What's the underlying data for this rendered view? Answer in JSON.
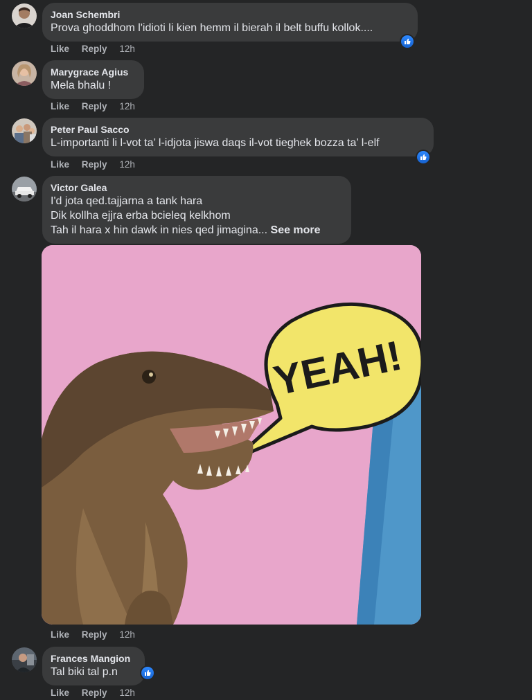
{
  "comments": [
    {
      "author": "Joan Schembri",
      "lines": [
        "Prova ghoddhom l'idioti li kien hemm il bierah il belt buffu kollok...."
      ],
      "like": "Like",
      "reply": "Reply",
      "time": "12h",
      "avatar_icon": "user-avatar",
      "reaction_icon": "like-reaction-icon"
    },
    {
      "author": "Marygrace Agius",
      "lines": [
        "Mela bhalu !"
      ],
      "like": "Like",
      "reply": "Reply",
      "time": "12h",
      "avatar_icon": "user-avatar"
    },
    {
      "author": "Peter Paul Sacco",
      "lines": [
        "L-importanti li l-vot ta’ l-idjota jiswa daqs il-vot tieghek bozza ta’ l-elf"
      ],
      "like": "Like",
      "reply": "Reply",
      "time": "12h",
      "avatar_icon": "user-avatar",
      "reaction_icon": "like-reaction-icon"
    },
    {
      "author": "Victor Galea",
      "lines": [
        "I'd jota qed.tajjarna a tank hara",
        "Dik kollha ejjra erba bcieleq kelkhom",
        "Tah il hara x hin dawk in nies qed jimagina..."
      ],
      "see_more": "See more",
      "like": "Like",
      "reply": "Reply",
      "time": "12h",
      "avatar_icon": "user-avatar",
      "attachment": {
        "type": "image",
        "speech_text": "YEAH!",
        "description_icon": "dinosaur-meme-image"
      }
    },
    {
      "author": "Frances Mangion",
      "lines": [
        "Tal biki tal p.n"
      ],
      "like": "Like",
      "reply": "Reply",
      "time": "12h",
      "avatar_icon": "user-avatar",
      "reaction_icon": "like-reaction-icon"
    }
  ],
  "colors": {
    "background": "#242526",
    "bubble": "#3a3b3c",
    "text": "#e4e6eb",
    "muted": "#b0b3b8",
    "like_blue": "#2d88ff"
  }
}
